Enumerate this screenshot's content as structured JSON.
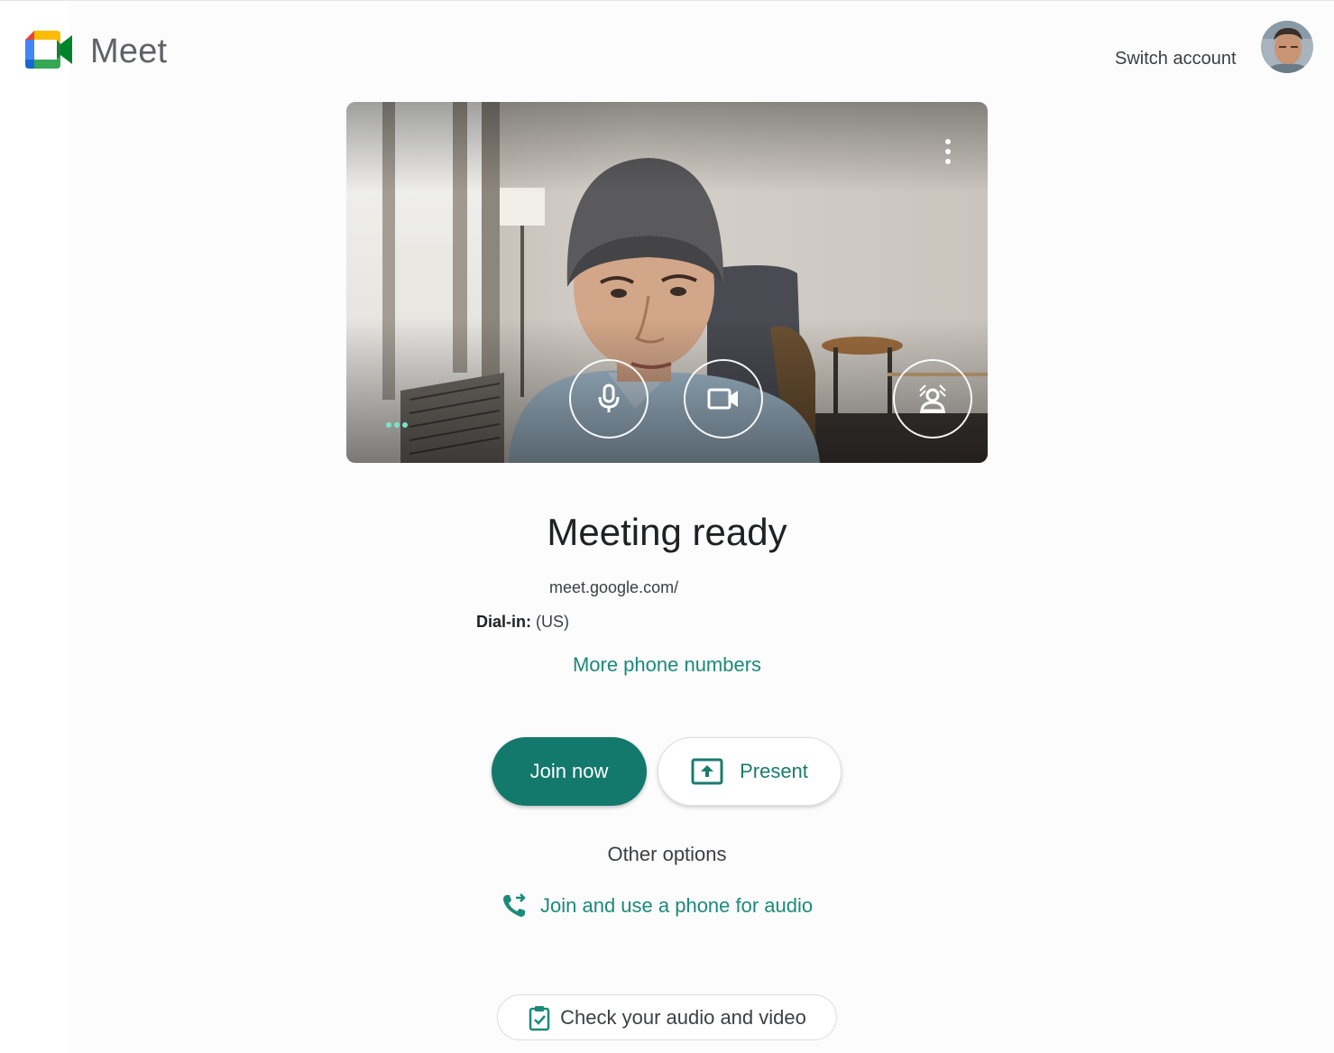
{
  "header": {
    "brand": "Meet",
    "switch_account": "Switch account"
  },
  "preview": {
    "mic_icon": "mic-icon",
    "camera_icon": "video-camera-icon",
    "effects_icon": "background-effects-icon",
    "more_icon": "more-vert-icon"
  },
  "meeting": {
    "title": "Meeting ready",
    "link": "meet.google.com/",
    "dial_in_label": "Dial-in:",
    "dial_in_value": "(US)",
    "more_numbers": "More phone numbers"
  },
  "actions": {
    "join": "Join now",
    "present": "Present",
    "other_options": "Other options",
    "phone_audio": "Join and use a phone for audio",
    "check_av": "Check your audio and video"
  },
  "colors": {
    "accent": "#13796d",
    "link": "#1b8a7a"
  }
}
